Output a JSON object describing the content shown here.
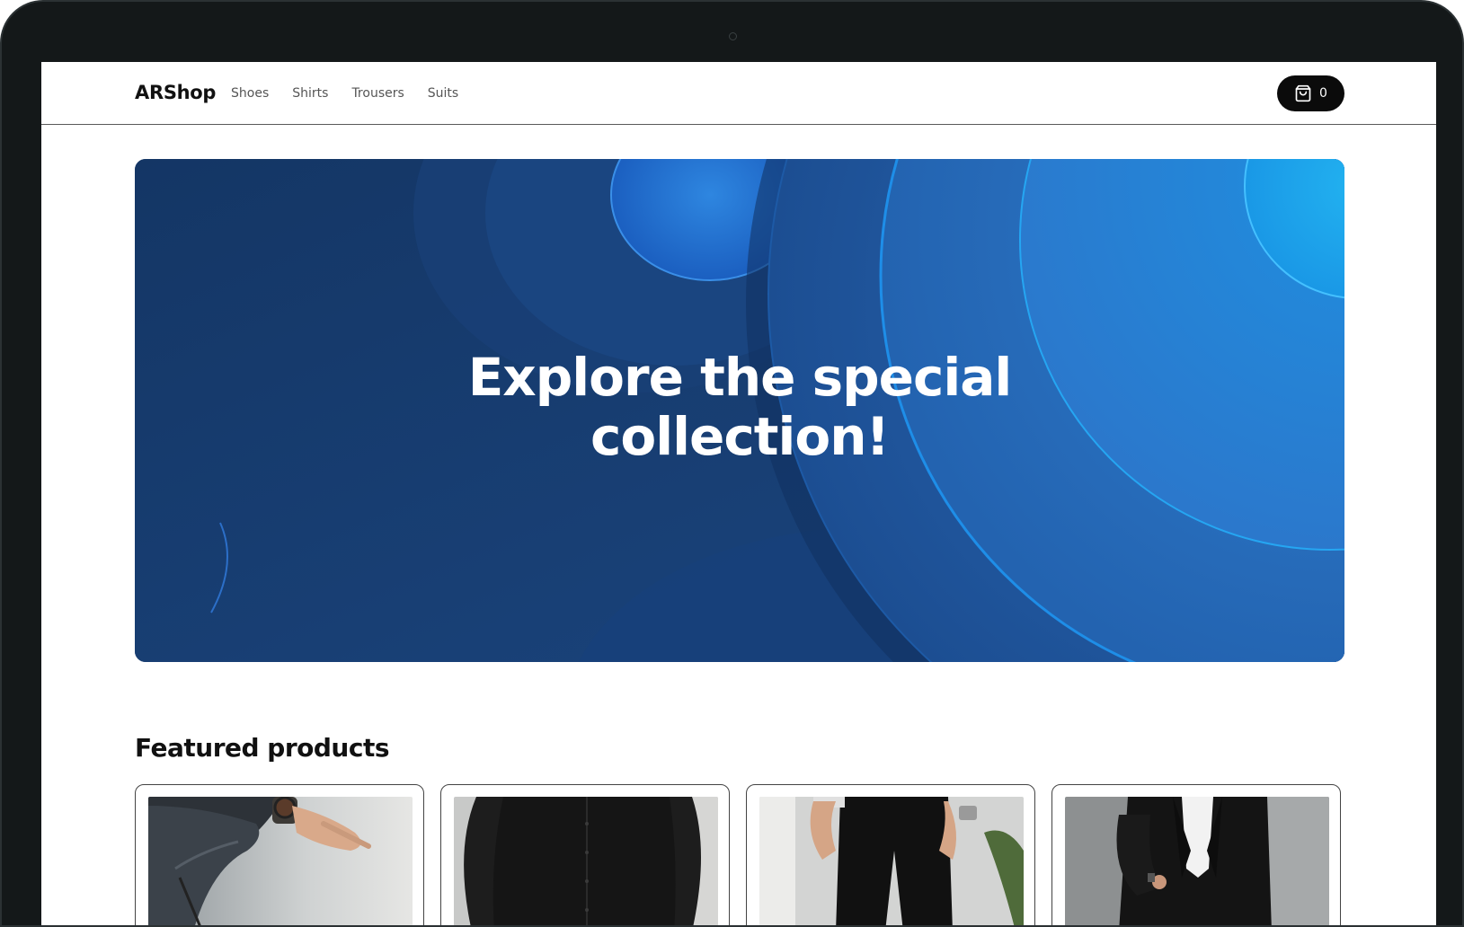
{
  "brand": "ARShop",
  "nav": {
    "items": [
      {
        "label": "Shoes"
      },
      {
        "label": "Shirts"
      },
      {
        "label": "Trousers"
      },
      {
        "label": "Suits"
      }
    ]
  },
  "cart": {
    "count": "0",
    "icon": "shopping-bag-icon"
  },
  "hero": {
    "title_line1": "Explore the special",
    "title_line2": "collection!"
  },
  "featured": {
    "title": "Featured products",
    "products": [
      {
        "image": "jeans-photo"
      },
      {
        "image": "black-shirt-photo"
      },
      {
        "image": "black-trousers-photo"
      },
      {
        "image": "black-suit-photo"
      }
    ]
  },
  "colors": {
    "hero_dark": "#163a6e",
    "hero_bright": "#1aa8ec",
    "cart_bg": "#0b0b0b",
    "bezel": "#141819"
  }
}
